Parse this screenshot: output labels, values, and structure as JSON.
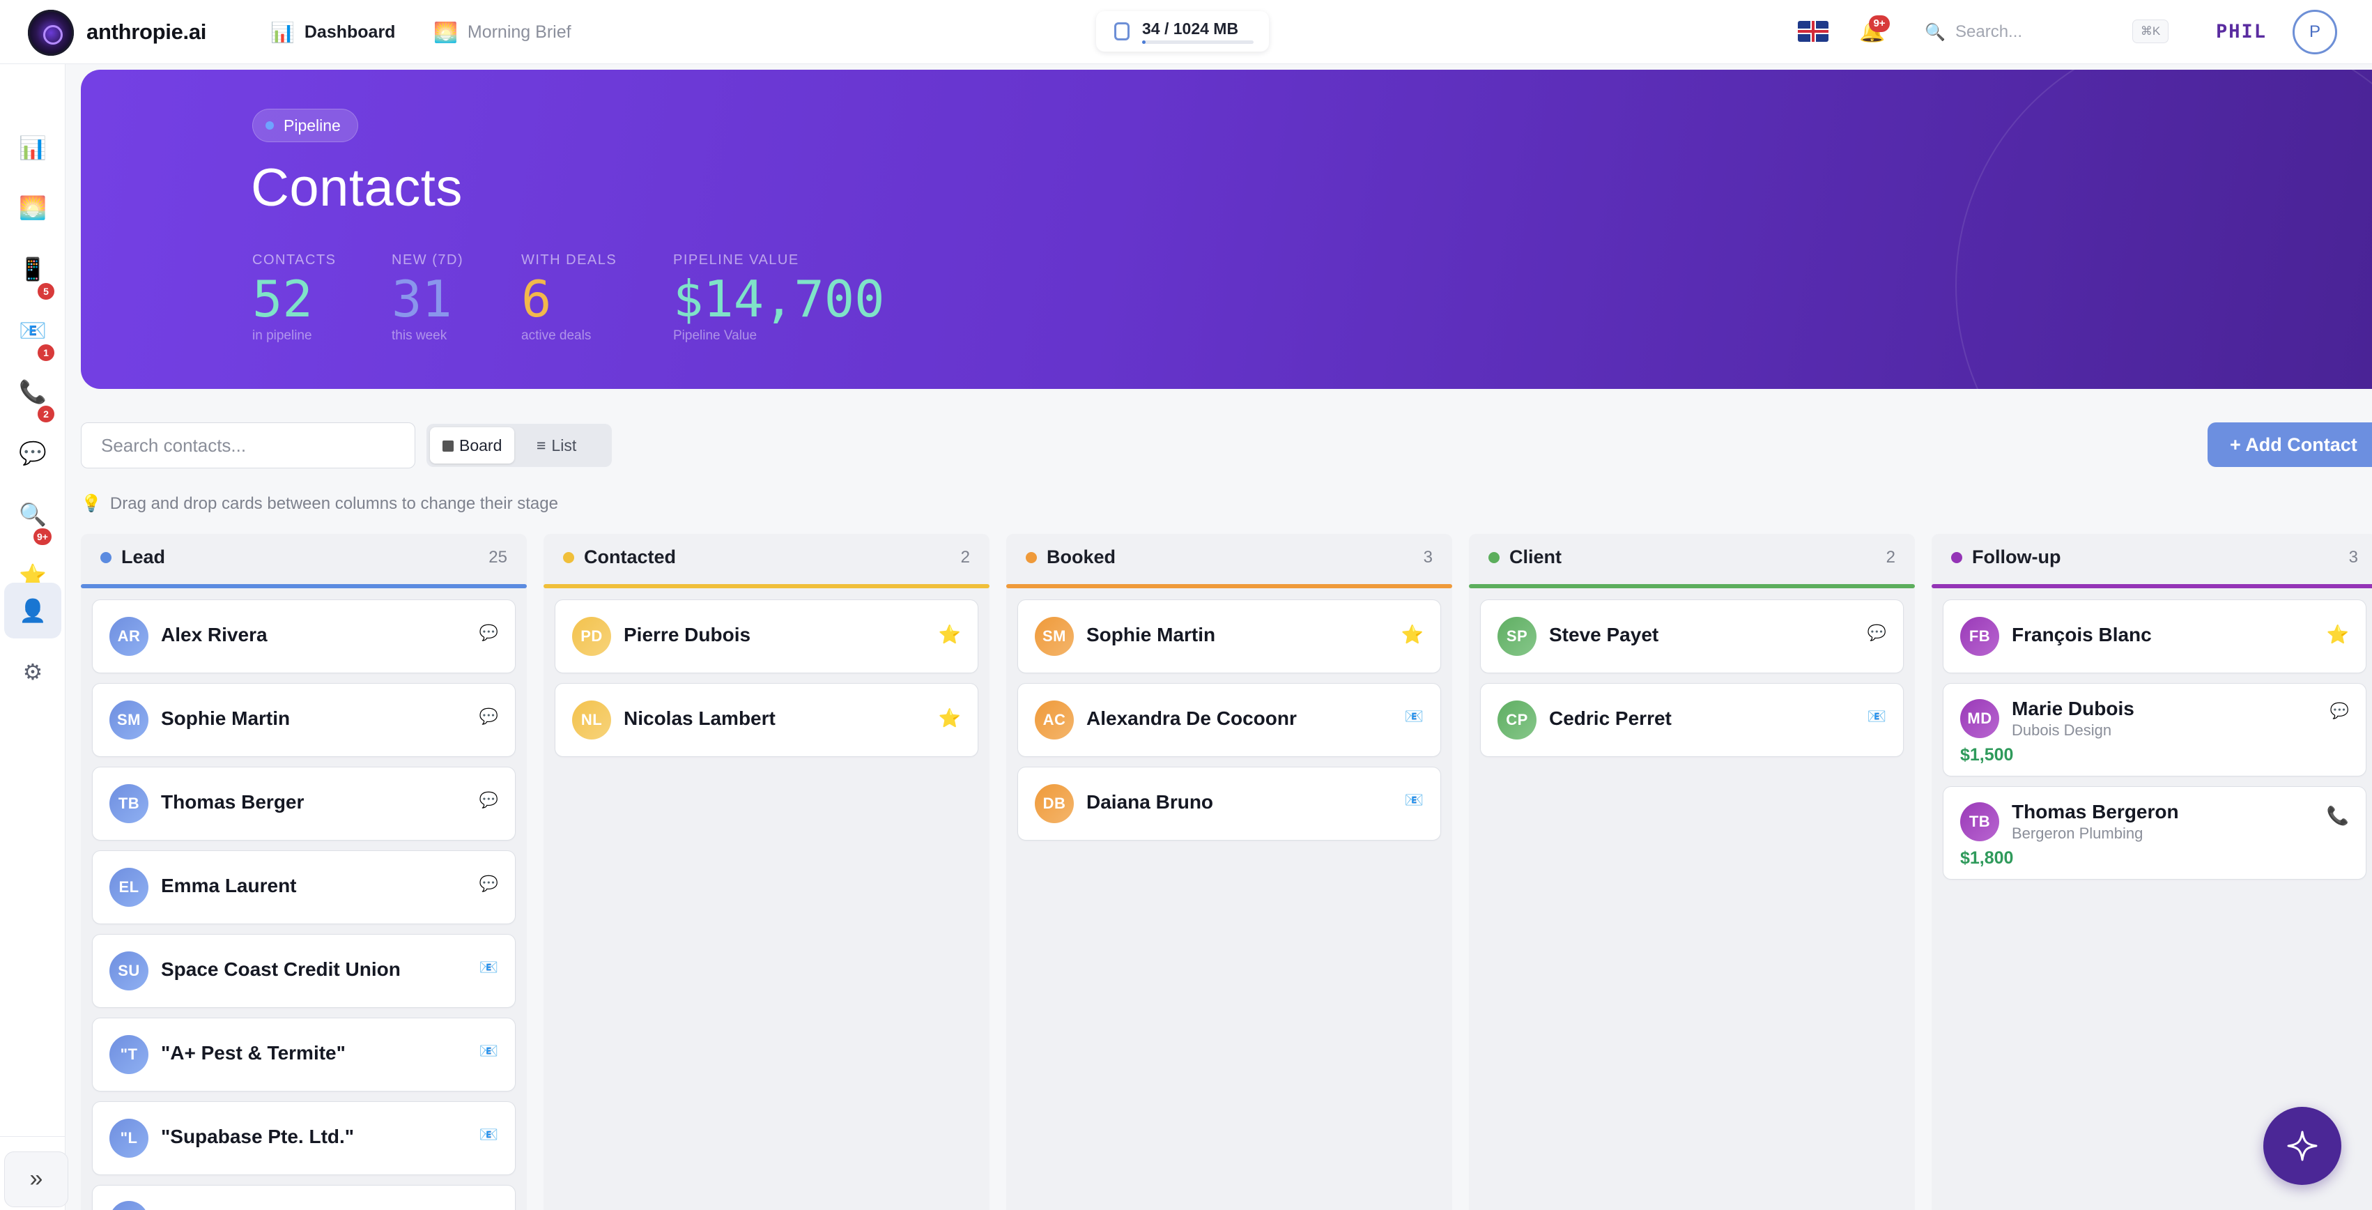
{
  "app": {
    "brand": "anthropie.ai",
    "nav": [
      {
        "icon": "📊",
        "label": "Dashboard"
      },
      {
        "icon": "🌅",
        "label": "Morning Brief"
      }
    ],
    "storage": {
      "text": "34 / 1024 MB",
      "used_fraction": 0.033
    },
    "notifications_badge": "9+",
    "search_placeholder": "Search...",
    "shortcut": "⌘K",
    "user_name": "PHIL",
    "user_initial": "P"
  },
  "sidebar": {
    "items": [
      {
        "icon": "📊",
        "badge": ""
      },
      {
        "icon": "🌅",
        "badge": ""
      },
      {
        "icon": "📱",
        "badge": ""
      },
      {
        "icon": "📧",
        "badge": "5"
      },
      {
        "icon": "📞",
        "badge": "1"
      },
      {
        "icon": "💬",
        "badge": "2"
      },
      {
        "icon": "🔍",
        "badge": ""
      },
      {
        "icon": "⭐",
        "badge": "9+"
      },
      {
        "icon": "👤",
        "badge": ""
      },
      {
        "icon": "⚙",
        "badge": ""
      }
    ],
    "collapse_label": "»"
  },
  "hero": {
    "pill": "Pipeline",
    "title": "Contacts",
    "stats": [
      {
        "label": "CONTACTS",
        "value": "52",
        "sub": "in pipeline",
        "color": "#7fe3c8"
      },
      {
        "label": "NEW (7D)",
        "value": "31",
        "sub": "this week",
        "color": "#8a96ec"
      },
      {
        "label": "WITH DEALS",
        "value": "6",
        "sub": "active deals",
        "color": "#f2b84b"
      },
      {
        "label": "PIPELINE VALUE",
        "value": "$14,700",
        "sub": "Pipeline Value",
        "color": "#7fe3c8"
      }
    ]
  },
  "toolbar": {
    "search_placeholder": "Search contacts...",
    "board_label": "Board",
    "list_label": "List",
    "add_label": "+ Add Contact",
    "hint": "Drag and drop cards between columns to change their stage"
  },
  "columns": [
    {
      "name": "Lead",
      "count": "25",
      "color": "#5b8be0",
      "cards": [
        {
          "initials": "AR",
          "name": "Alex Rivera",
          "icon": "💬"
        },
        {
          "initials": "SM",
          "name": "Sophie Martin",
          "icon": "💬"
        },
        {
          "initials": "TB",
          "name": "Thomas Berger",
          "icon": "💬"
        },
        {
          "initials": "EL",
          "name": "Emma Laurent",
          "icon": "💬"
        },
        {
          "initials": "SU",
          "name": "Space Coast Credit Union",
          "icon": "📧"
        },
        {
          "initials": "\"T",
          "name": "\"A+ Pest & Termite\"",
          "icon": "📧"
        },
        {
          "initials": "\"L",
          "name": "\"Supabase Pte. Ltd.\"",
          "icon": "📧"
        }
      ]
    },
    {
      "name": "Contacted",
      "count": "2",
      "color": "#f0bf3a",
      "cards": [
        {
          "initials": "PD",
          "name": "Pierre Dubois",
          "icon": "⭐"
        },
        {
          "initials": "NL",
          "name": "Nicolas Lambert",
          "icon": "⭐"
        }
      ]
    },
    {
      "name": "Booked",
      "count": "3",
      "color": "#ef9a3a",
      "cards": [
        {
          "initials": "SM",
          "name": "Sophie Martin",
          "icon": "⭐"
        },
        {
          "initials": "AC",
          "name": "Alexandra De Cocoonr",
          "icon": "📧"
        },
        {
          "initials": "DB",
          "name": "Daiana Bruno",
          "icon": "📧"
        }
      ]
    },
    {
      "name": "Client",
      "count": "2",
      "color": "#5cae5c",
      "cards": [
        {
          "initials": "SP",
          "name": "Steve Payet",
          "icon": "💬"
        },
        {
          "initials": "CP",
          "name": "Cedric Perret",
          "icon": "📧"
        }
      ]
    },
    {
      "name": "Follow-up",
      "count": "3",
      "color": "#9434b6",
      "cards": [
        {
          "initials": "FB",
          "name": "François Blanc",
          "icon": "⭐"
        },
        {
          "initials": "MD",
          "name": "Marie Dubois",
          "company": "Dubois Design",
          "amount": "$1,500",
          "icon": "💬"
        },
        {
          "initials": "TB",
          "name": "Thomas Bergeron",
          "company": "Bergeron Plumbing",
          "amount": "$1,800",
          "icon": "📞"
        }
      ]
    }
  ]
}
